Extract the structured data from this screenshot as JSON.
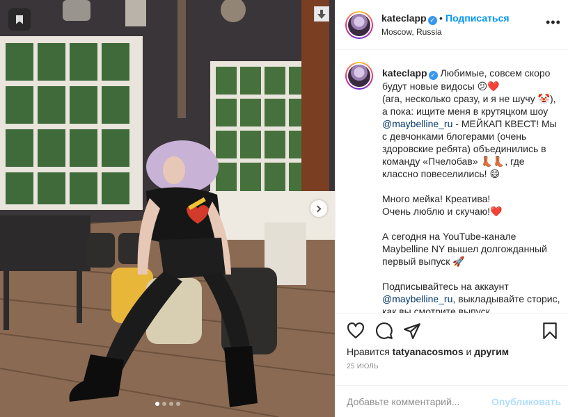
{
  "post": {
    "username": "kateclapp",
    "follow_label": "Подписаться",
    "bullet": "•",
    "location": "Moscow, Russia",
    "more_label": "•••",
    "caption_paragraphs": [
      "Любимые, совсем скоро будут новые видосы 😕❤️\n(ага, несколько сразу, и я не шучу 🤡), а пока: ищите меня в крутяцком шоу ",
      "Много мейка! Креатива!\nОчень люблю и скучаю!❤️",
      "А сегодня на YouTube-канале Maybelline NY вышел долгожданный первый выпуск 🚀",
      "Подписывайтесь на аккаунт "
    ],
    "caption_mention_1": "@maybelline_ru",
    "caption_after_mention_1": " - МЕЙКАП КВЕСТ! Мы с девчонками блогерами (очень здоровские ребята) объединились в команду «Пчелобав» 👢👢, где классно повеселились! 😄",
    "caption_mention_2": "@maybelline_ru",
    "caption_after_mention_2": ", выкладывайте сторис, как вы смотрите выпуск",
    "likes_prefix": "Нравится",
    "likes_user": "tatyanacosmos",
    "likes_mid": "и",
    "likes_others": "другим",
    "date": "25 июль",
    "comment_placeholder": "Добавьте комментарий...",
    "publish_label": "Опубликовать"
  },
  "carousel": {
    "count": 4,
    "active_index": 0
  },
  "icons": [
    "bookmark-icon",
    "download-icon",
    "chevron-right-icon",
    "heart-icon",
    "comment-icon",
    "share-icon",
    "save-icon",
    "verified-icon"
  ],
  "colors": {
    "link": "#0095f6",
    "mention": "#00376b",
    "publish_disabled": "#b2dffc",
    "secondary_text": "#8e8e8e"
  }
}
